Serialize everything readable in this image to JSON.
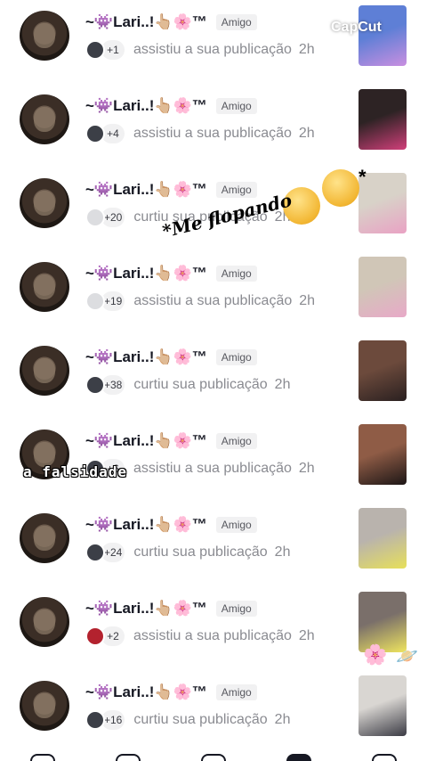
{
  "notifications": [
    {
      "username": "~👾Lari..!👆🏼🌸™",
      "badge": "Amigo",
      "count": "+1",
      "action": "assistiu a sua publicação",
      "time": "2h",
      "mini_avatar": "dark",
      "thumb": [
        "#5e7fd6",
        "#c98fe0"
      ]
    },
    {
      "username": "~👾Lari..!👆🏼🌸™",
      "badge": "Amigo",
      "count": "+4",
      "action": "assistiu a sua publicação",
      "time": "2h",
      "mini_avatar": "dark",
      "thumb": [
        "#2d2324",
        "#d13f7a"
      ]
    },
    {
      "username": "~👾Lari..!👆🏼🌸™",
      "badge": "Amigo",
      "count": "+20",
      "action": "curtiu sua publicação",
      "time": "2h",
      "mini_avatar": "light",
      "thumb": [
        "#d8d2c8",
        "#e9a2c4"
      ]
    },
    {
      "username": "~👾Lari..!👆🏼🌸™",
      "badge": "Amigo",
      "count": "+19",
      "action": "assistiu a sua publicação",
      "time": "2h",
      "mini_avatar": "light",
      "thumb": [
        "#d0c6b7",
        "#e8a9c8"
      ]
    },
    {
      "username": "~👾Lari..!👆🏼🌸™",
      "badge": "Amigo",
      "count": "+38",
      "action": "curtiu sua publicação",
      "time": "2h",
      "mini_avatar": "dark",
      "thumb": [
        "#6c4a3c",
        "#2a2020"
      ]
    },
    {
      "username": "~👾Lari..!👆🏼🌸™",
      "badge": "Amigo",
      "count": "+6",
      "action": "assistiu a sua publicação",
      "time": "2h",
      "mini_avatar": "dark",
      "thumb": [
        "#8f5c46",
        "#1d1616"
      ]
    },
    {
      "username": "~👾Lari..!👆🏼🌸™",
      "badge": "Amigo",
      "count": "+24",
      "action": "curtiu sua publicação",
      "time": "2h",
      "mini_avatar": "dark",
      "thumb": [
        "#b9b3ad",
        "#e7e05a"
      ]
    },
    {
      "username": "~👾Lari..!👆🏼🌸™",
      "badge": "Amigo",
      "count": "+2",
      "action": "assistiu a sua publicação",
      "time": "2h",
      "mini_avatar": "red",
      "thumb": [
        "#7a6f6a",
        "#efe55f"
      ]
    },
    {
      "username": "~👾Lari..!👆🏼🌸™",
      "badge": "Amigo",
      "count": "+16",
      "action": "curtiu sua publicação",
      "time": "2h",
      "mini_avatar": "dark",
      "thumb": [
        "#d9d6d2",
        "#3b3b44"
      ]
    }
  ],
  "overlays": {
    "flopando": "*Me flopando",
    "falsidade": "a falsidade",
    "asterisk": "*",
    "capcut": "CapCut",
    "flower_emoji": "🌸",
    "planet_emoji": "🪐",
    "face1_emoji": "😒",
    "face2_emoji": "🙄"
  }
}
